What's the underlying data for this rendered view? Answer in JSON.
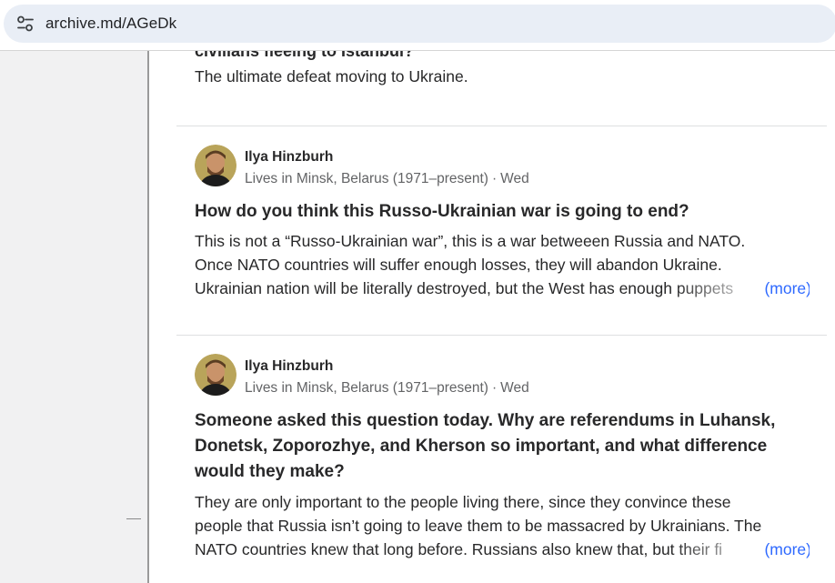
{
  "browser": {
    "url": "archive.md/AGeDk",
    "site_icon": "tune-icon"
  },
  "feed": {
    "cut_title": "civilians fleeing to Istanbul?",
    "prev_excerpt": "The ultimate defeat moving to Ukraine.",
    "posts": [
      {
        "author": "Ilya Hinzburh",
        "credential": "Lives in Minsk, Belarus (1971–present)",
        "separator": "·",
        "time": "Wed",
        "question_lines": [
          "How do you think this Russo-Ukrainian war is going to end?"
        ],
        "excerpt_lines": [
          "This is not a “Russo-Ukrainian war”, this is a war betweeen Russia and NATO.",
          "Once NATO countries will suffer enough losses, they will abandon Ukraine.",
          "Ukrainian nation will be literally destroyed, but the West has enough puppets"
        ],
        "more_label": "(more)"
      },
      {
        "author": "Ilya Hinzburh",
        "credential": "Lives in Minsk, Belarus (1971–present)",
        "separator": "·",
        "time": "Wed",
        "question_lines": [
          "Someone asked this question today. Why are referendums in Luhansk,",
          "Donetsk, Zoporozhye, and Kherson so important, and what difference",
          "would they make?"
        ],
        "excerpt_lines": [
          "They are only important to the people living there, since they convince these",
          "people that Russia isn’t going to leave them to be massacred by Ukrainians. The",
          "NATO countries knew that long before. Russians also knew that, but their fi"
        ],
        "more_label": "(more)"
      }
    ]
  }
}
